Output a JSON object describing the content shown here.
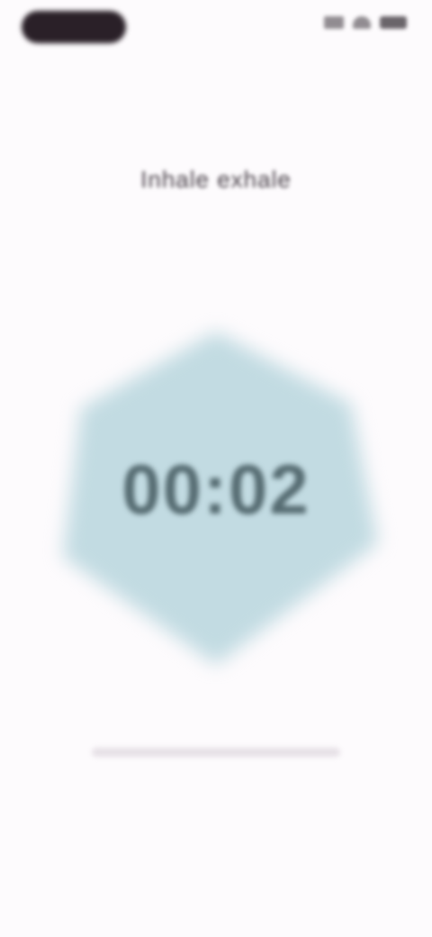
{
  "status_bar": {
    "indicators": [
      "pill",
      "signal-icon",
      "wifi-icon",
      "battery-icon"
    ]
  },
  "title": "Inhale exhale",
  "timer": {
    "display": "00:02",
    "shape_color": "#c2dbe2"
  },
  "colors": {
    "background": "#fdfbfd",
    "title": "#4a424a",
    "timer_text": "#566c72"
  }
}
